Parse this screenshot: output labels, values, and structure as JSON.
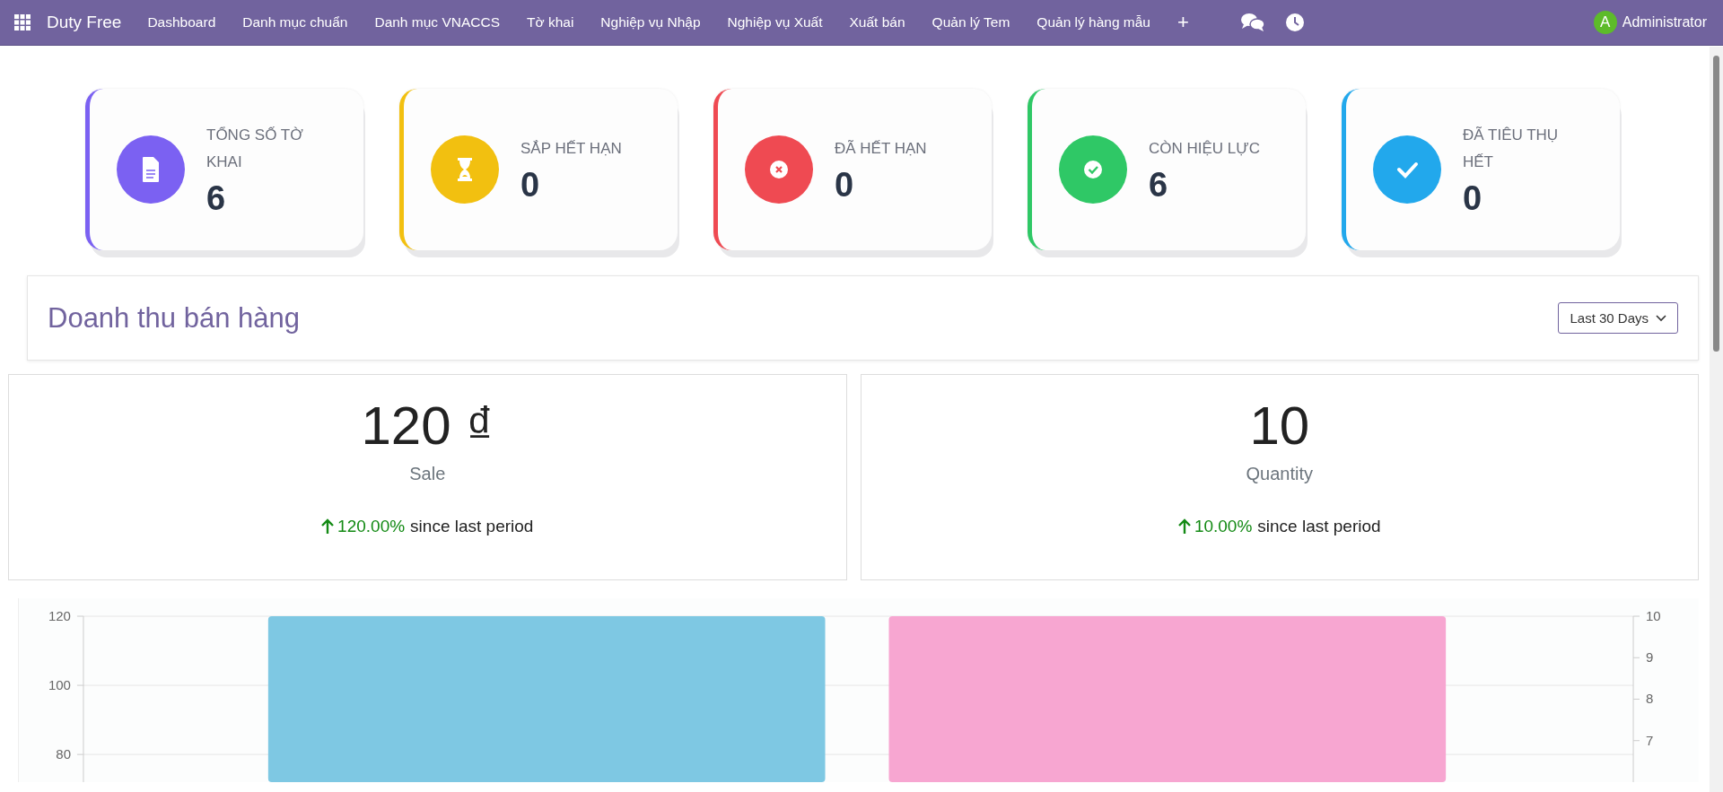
{
  "navbar": {
    "brand": "Duty Free",
    "menu": [
      "Dashboard",
      "Danh mục chuẩn",
      "Danh mục VNACCS",
      "Tờ khai",
      "Nghiệp vụ Nhập",
      "Nghiệp vụ Xuất",
      "Xuất bán",
      "Quản lý Tem",
      "Quản lý hàng mẫu"
    ],
    "add": "+",
    "user": {
      "initial": "A",
      "name": "Administrator"
    }
  },
  "cards": [
    {
      "kind": "document",
      "label": "TỔNG SỐ TỜ KHAI",
      "value": "6",
      "color": "#7b61f2"
    },
    {
      "kind": "hourglass",
      "label": "SẮP HẾT HẠN",
      "value": "0",
      "color": "#f2c010"
    },
    {
      "kind": "cross",
      "label": "ĐÃ HẾT HẠN",
      "value": "0",
      "color": "#ef4a52"
    },
    {
      "kind": "check-circle",
      "label": "CÒN HIỆU LỰC",
      "value": "6",
      "color": "#2fc866"
    },
    {
      "kind": "check",
      "label": "ĐÃ TIÊU THỤ HẾT",
      "value": "0",
      "color": "#22a8ec"
    }
  ],
  "sales_header": {
    "title": "Doanh thu bán hàng",
    "period": "Last 30 Days"
  },
  "stats": [
    {
      "value": "120 ₫",
      "label": "Sale",
      "change": "120.00%",
      "change_label": "since last period"
    },
    {
      "value": "10",
      "label": "Quantity",
      "change": "10.00%",
      "change_label": "since last period"
    }
  ],
  "chart": {
    "chart_data": {
      "type": "bar",
      "ylim": [
        72,
        120
      ],
      "y2lim": [
        6,
        10
      ],
      "yticks": [
        80,
        100,
        120
      ],
      "y2ticks": [
        7,
        8,
        9,
        10
      ],
      "series": [
        {
          "color": "#7ec8e3",
          "values": [
            120
          ]
        },
        {
          "color": "#f7a6d1",
          "values": [
            10
          ],
          "axis": "y2"
        }
      ]
    }
  }
}
